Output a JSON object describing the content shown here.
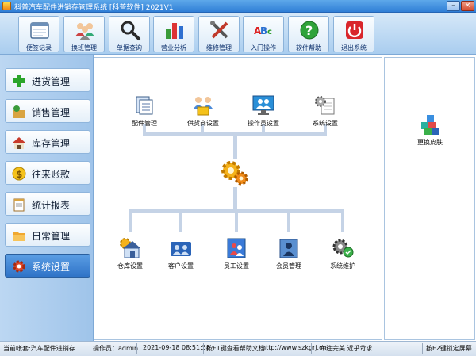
{
  "window": {
    "title": "科普汽车配件进销存管理系统 [科普软件] 2021V1",
    "minimize_label": "–",
    "close_label": "×"
  },
  "toolbar": [
    {
      "label": "便签记录",
      "icon": "notepad-icon"
    },
    {
      "label": "换班管理",
      "icon": "users-group-icon"
    },
    {
      "label": "单据查询",
      "icon": "magnifier-icon"
    },
    {
      "label": "营业分析",
      "icon": "bar-chart-icon"
    },
    {
      "label": "维修管理",
      "icon": "tools-icon"
    },
    {
      "label": "入门操作",
      "icon": "abc-icon"
    },
    {
      "label": "软件帮助",
      "icon": "help-icon"
    },
    {
      "label": "退出系统",
      "icon": "power-icon"
    }
  ],
  "nav": [
    {
      "label": "进货管理",
      "icon": "plus-icon"
    },
    {
      "label": "销售管理",
      "icon": "sales-icon"
    },
    {
      "label": "库存管理",
      "icon": "house-icon"
    },
    {
      "label": "往来账款",
      "icon": "money-icon"
    },
    {
      "label": "统计报表",
      "icon": "report-icon"
    },
    {
      "label": "日常管理",
      "icon": "folder-icon"
    },
    {
      "label": "系统设置",
      "icon": "gear-icon",
      "active": true
    }
  ],
  "main": {
    "top_items": [
      {
        "label": "配件管理",
        "icon": "parts-icon"
      },
      {
        "label": "供货商设置",
        "icon": "supplier-icon"
      },
      {
        "label": "操作员设置",
        "icon": "operator-icon"
      },
      {
        "label": "系统设置",
        "icon": "settings-doc-icon"
      }
    ],
    "center_icon": "gears-hub-icon",
    "bottom_items": [
      {
        "label": "仓库设置",
        "icon": "warehouse-icon"
      },
      {
        "label": "客户设置",
        "icon": "customer-icon"
      },
      {
        "label": "员工设置",
        "icon": "employee-icon"
      },
      {
        "label": "会员管理",
        "icon": "member-icon"
      },
      {
        "label": "系统维护",
        "icon": "maintenance-icon"
      }
    ]
  },
  "right": {
    "label": "更换皮肤",
    "icon": "skin-cube-icon"
  },
  "status": {
    "account": "当前帐套:汽车配件进销存",
    "operator": "操作员：admin",
    "datetime": "2021-09-18 08:51:58",
    "help": "按F1键查看帮助文档",
    "url": "http://www.szkgrj.cn/",
    "slogan": "专注完美 近乎苛求",
    "lock": "按F2键锁定屏幕"
  }
}
